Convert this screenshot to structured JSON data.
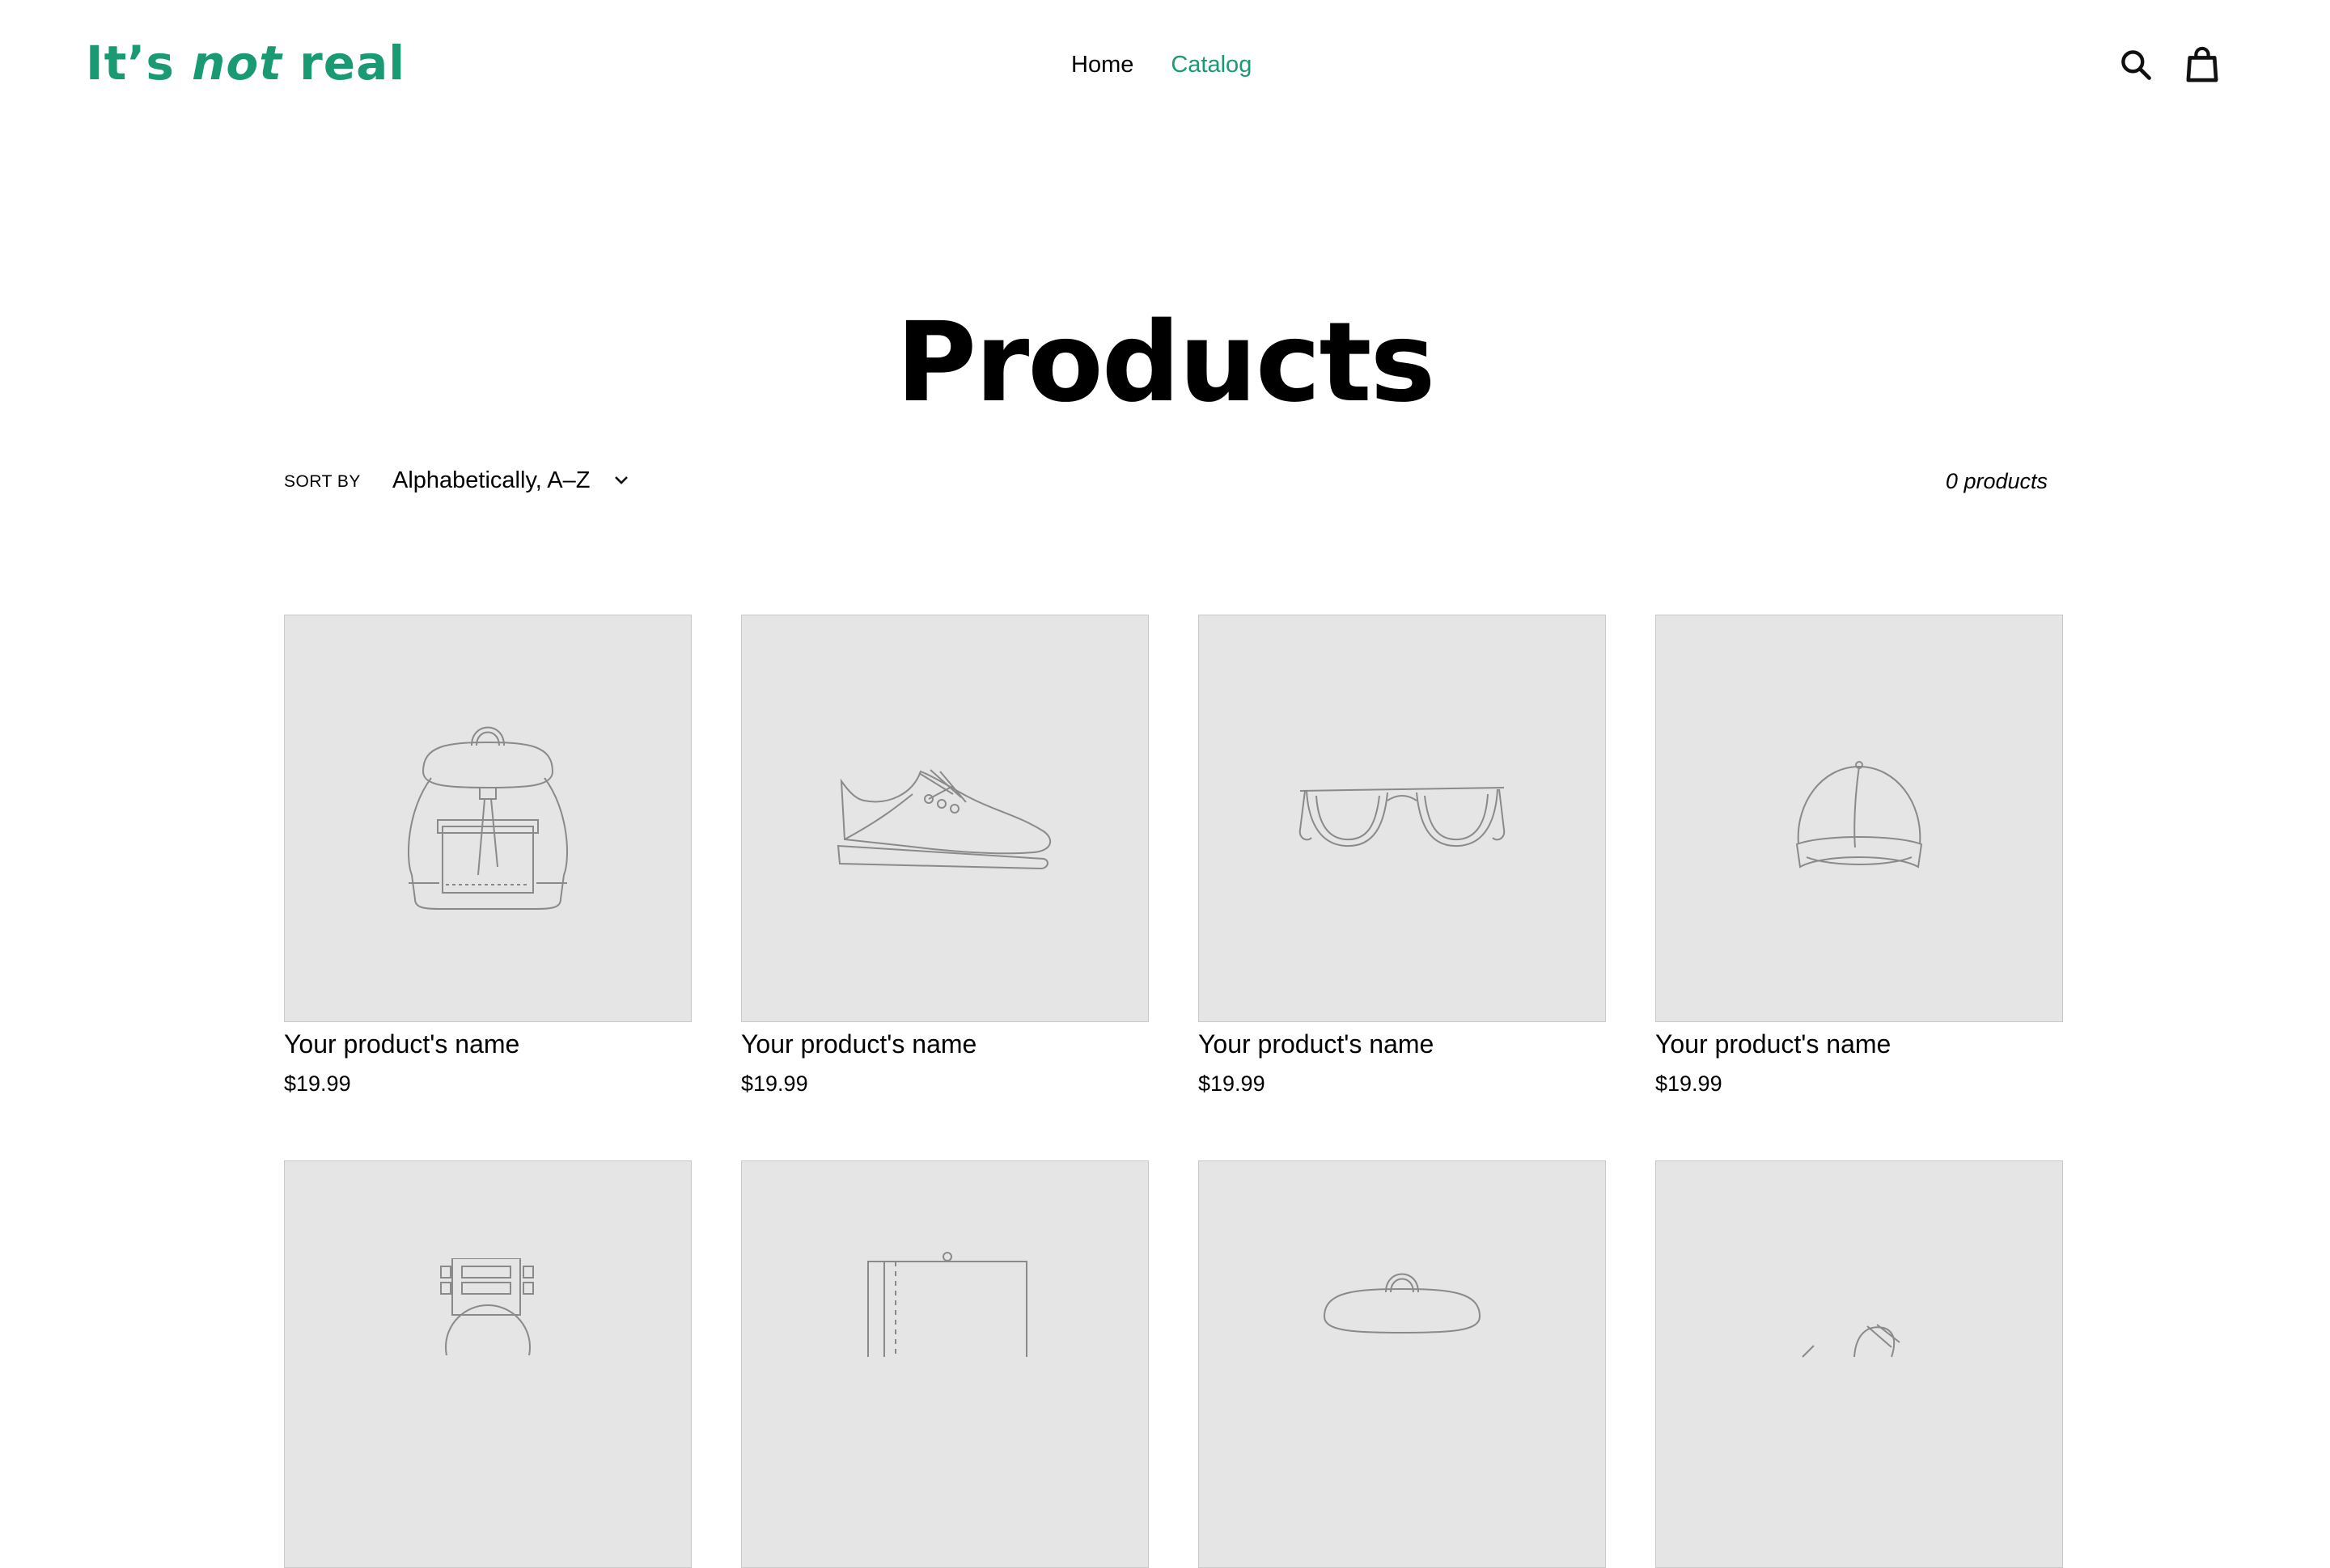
{
  "header": {
    "logo": {
      "part1": "It’s ",
      "part2": "not",
      "part3": " real"
    },
    "nav": [
      {
        "label": "Home",
        "active": false
      },
      {
        "label": "Catalog",
        "active": true
      }
    ],
    "icons": [
      "search-icon",
      "cart-icon"
    ]
  },
  "page": {
    "title": "Products"
  },
  "toolbar": {
    "sort_label": "SORT BY",
    "sort_value": "Alphabetically, A–Z",
    "count": "0 products"
  },
  "products": [
    {
      "name": "Your product's name",
      "price": "$19.99",
      "icon": "backpack-icon"
    },
    {
      "name": "Your product's name",
      "price": "$19.99",
      "icon": "sneaker-icon"
    },
    {
      "name": "Your product's name",
      "price": "$19.99",
      "icon": "sunglasses-icon"
    },
    {
      "name": "Your product's name",
      "price": "$19.99",
      "icon": "cap-icon"
    },
    {
      "icon": "watch-icon"
    },
    {
      "icon": "notebook-icon"
    },
    {
      "icon": "backpack-icon"
    },
    {
      "icon": "sneaker-icon"
    }
  ],
  "colors": {
    "accent": "#1a9a73",
    "placeholder_bg": "#e5e5e5",
    "icon_stroke": "#8a8a8a"
  }
}
